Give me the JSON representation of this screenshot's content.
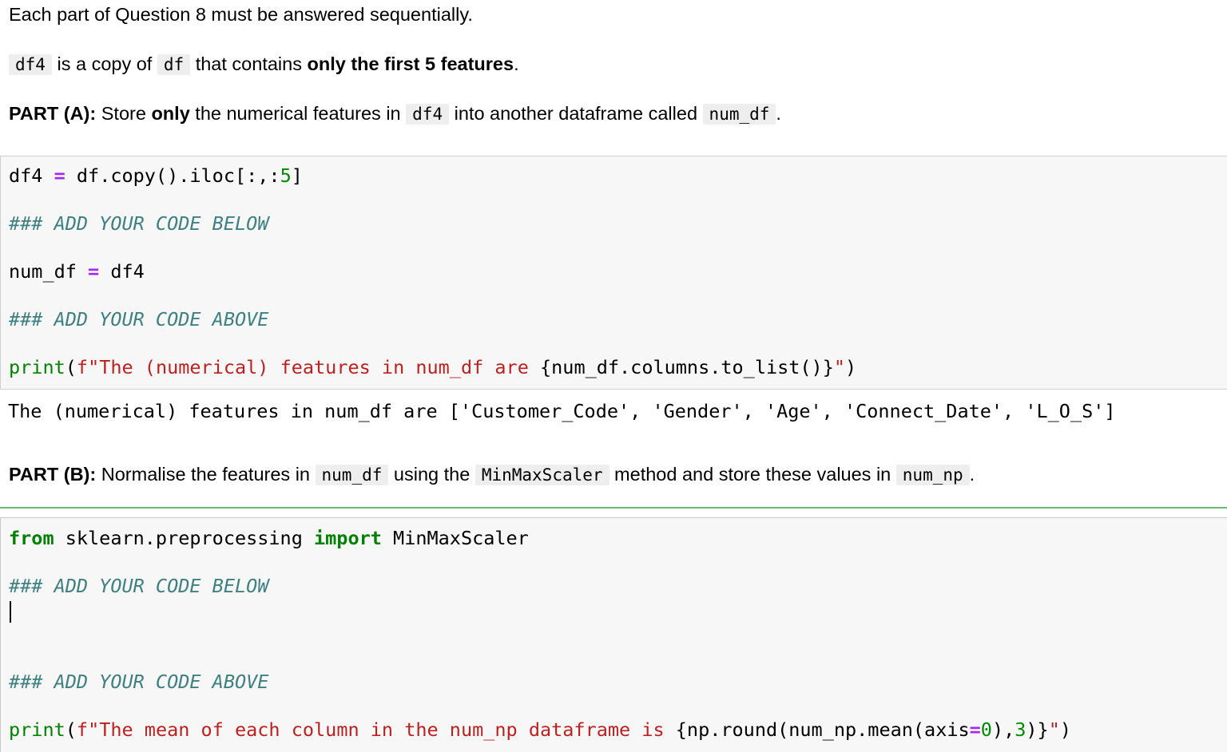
{
  "intro": {
    "text": "Each part of Question 8 must be answered sequentially."
  },
  "desc": {
    "code1": "df4",
    "t1": " is a copy of ",
    "code2": "df",
    "t2": " that contains ",
    "bold": "only the first 5 features",
    "t3": "."
  },
  "partA": {
    "label": "PART (A):",
    "t1": " Store ",
    "bold": "only",
    "t2": " the numerical features in ",
    "code1": "df4",
    "t3": " into another dataframe called ",
    "code2": "num_df",
    "t4": "."
  },
  "cellA": {
    "l1_a": "df4 ",
    "l1_op": "=",
    "l1_b": " df.copy().iloc[:,:",
    "l1_num": "5",
    "l1_c": "]",
    "l2_comment": "### ADD YOUR CODE BELOW",
    "l3_a": "num_df ",
    "l3_op": "=",
    "l3_b": " df4",
    "l4_comment": "### ADD YOUR CODE ABOVE",
    "l5_fn": "print",
    "l5_p": "(",
    "l5_prefix": "f",
    "l5_str1": "\"The (numerical) features in num_df are ",
    "l5_expr": "{num_df.columns.to_list()}",
    "l5_str2": "\"",
    "l5_close": ")"
  },
  "outputA": {
    "text": "The (numerical) features in num_df are ['Customer_Code', 'Gender', 'Age', 'Connect_Date', 'L_O_S']"
  },
  "partB": {
    "label": "PART (B):",
    "t1": " Normalise the features in ",
    "code1": "num_df",
    "t2": " using the ",
    "code2": "MinMaxScaler",
    "t3": " method and store these values in ",
    "code3": "num_np",
    "t4": "."
  },
  "cellB": {
    "l1_kw1": "from",
    "l1_a": " sklearn.preprocessing ",
    "l1_kw2": "import",
    "l1_b": " MinMaxScaler",
    "l2_comment": "### ADD YOUR CODE BELOW",
    "l4_comment": "### ADD YOUR CODE ABOVE",
    "l5_fn": "print",
    "l5_p": "(",
    "l5_prefix": "f",
    "l5_str1": "\"The mean of each column in the num_np dataframe is ",
    "l5_expr1": "{np.round(num_np.mean(axis",
    "l5_op": "=",
    "l5_num": "0",
    "l5_expr2": "),",
    "l5_num2": "3",
    "l5_expr3": ")}",
    "l5_str2": "\"",
    "l5_close": ")"
  }
}
